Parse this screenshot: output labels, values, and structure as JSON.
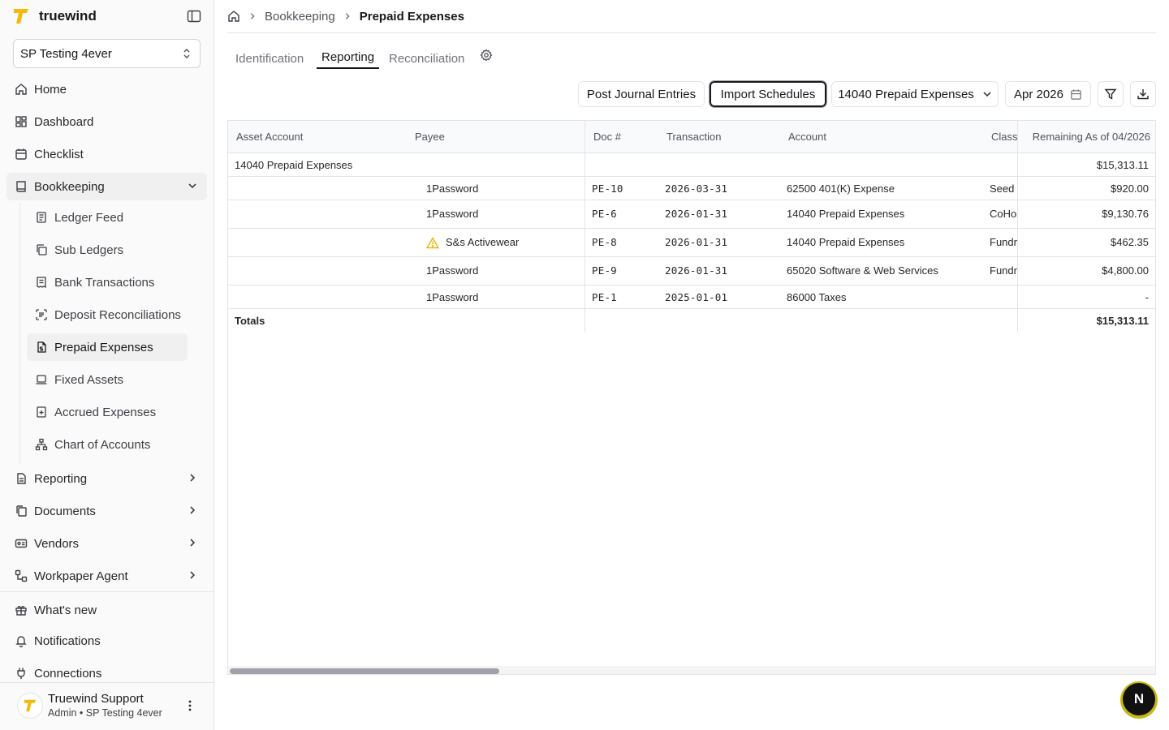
{
  "app": {
    "name": "truewind"
  },
  "company_selector": {
    "value": "SP Testing 4ever"
  },
  "sidebar": {
    "home": "Home",
    "dashboard": "Dashboard",
    "checklist": "Checklist",
    "bookkeeping": "Bookkeeping",
    "sub_items": [
      "Ledger Feed",
      "Sub Ledgers",
      "Bank Transactions",
      "Deposit Reconciliations",
      "Prepaid Expenses",
      "Fixed Assets",
      "Accrued Expenses",
      "Chart of Accounts"
    ],
    "reporting": "Reporting",
    "documents": "Documents",
    "vendors": "Vendors",
    "workpaper_agent": "Workpaper Agent",
    "whats_new": "What's new",
    "notifications": "Notifications",
    "connections": "Connections"
  },
  "user": {
    "name": "Truewind Support",
    "role": "Admin • SP Testing 4ever"
  },
  "breadcrumb": {
    "section": "Bookkeeping",
    "current": "Prepaid Expenses"
  },
  "tabs": [
    "Identification",
    "Reporting",
    "Reconciliation"
  ],
  "toolbar": {
    "post_journal": "Post Journal Entries",
    "import_schedules": "Import Schedules",
    "account_filter": "14040 Prepaid Expenses",
    "period": "Apr 2026"
  },
  "table": {
    "headers": {
      "asset_account": "Asset Account",
      "payee": "Payee",
      "doc": "Doc #",
      "transaction": "Transaction",
      "account": "Account",
      "class": "Class",
      "remaining": "Remaining As of 04/2026"
    },
    "group": {
      "label": "14040 Prepaid Expenses",
      "remaining": "$15,313.11"
    },
    "rows": [
      {
        "payee": "1Password",
        "doc": "PE-10",
        "date": "2026-03-31",
        "account": "62500 401(K) Expense",
        "class": "Seed I",
        "remaining": "$920.00"
      },
      {
        "payee": "1Password",
        "doc": "PE-6",
        "date": "2026-01-31",
        "account": "14040 Prepaid Expenses",
        "class": "CoHos",
        "remaining": "$9,130.76"
      },
      {
        "payee": "S&s Activewear",
        "doc": "PE-8",
        "date": "2026-01-31",
        "account": "14040 Prepaid Expenses",
        "class": "Fundra",
        "remaining": "$462.35"
      },
      {
        "payee": "1Password",
        "doc": "PE-9",
        "date": "2026-01-31",
        "account": "65020 Software & Web Services",
        "class": "Fundra",
        "remaining": "$4,800.00"
      },
      {
        "payee": "1Password",
        "doc": "PE-1",
        "date": "2025-01-01",
        "account": "86000 Taxes",
        "class": "",
        "remaining": "-"
      }
    ],
    "totals": {
      "label": "Totals",
      "remaining": "$15,313.11"
    }
  },
  "badge": {
    "letter": "N"
  },
  "colors": {
    "brand": "#f5b90a",
    "warning": "#eab308"
  }
}
